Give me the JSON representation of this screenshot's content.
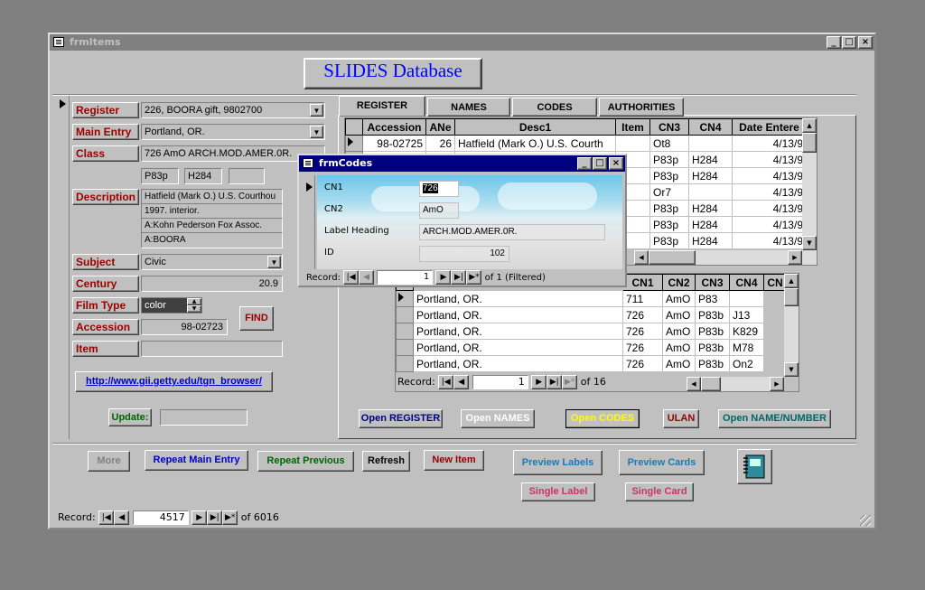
{
  "main_window": {
    "title": "frmItems"
  },
  "header": {
    "title": "SLIDES Database"
  },
  "fields": {
    "register": {
      "label": "Register",
      "value": "226, BOORA gift, 9802700"
    },
    "main_entry": {
      "label": "Main Entry",
      "value": "Portland, OR."
    },
    "class": {
      "label": "Class",
      "value": "726  AmO  ARCH.MOD.AMER.0R.",
      "sub1": "P83p",
      "sub2": "H284",
      "sub3": ""
    },
    "description": {
      "label": "Description",
      "lines": [
        "Hatfield (Mark O.) U.S. Courthou",
        "1997. interior.",
        "A:Kohn Pederson Fox Assoc.",
        "A:BOORA"
      ]
    },
    "subject": {
      "label": "Subject",
      "value": "Civic"
    },
    "century": {
      "label": "Century",
      "value": "20.9"
    },
    "film_type": {
      "label": "Film Type",
      "value": "color"
    },
    "accession": {
      "label": "Accession",
      "value": "98-02723"
    },
    "item": {
      "label": "Item",
      "value": ""
    }
  },
  "find_button": "FIND",
  "link": "http://www.gii.getty.edu/tgn_browser/",
  "update": {
    "label": "Update:",
    "value": ""
  },
  "tabs": [
    "REGISTER",
    "NAMES",
    "CODES",
    "AUTHORITIES"
  ],
  "grid1": {
    "headers": [
      "Accession",
      "ANe",
      "Desc1",
      "Item",
      "CN3",
      "CN4",
      "Date Entere"
    ],
    "rows": [
      [
        "98-02725",
        "26",
        "Hatfield (Mark O.) U.S. Courth",
        "",
        "Ot8",
        "",
        "4/13/9"
      ],
      [
        "",
        "",
        "",
        "",
        "P83p",
        "H284",
        "4/13/9"
      ],
      [
        "",
        "",
        "",
        "",
        "P83p",
        "H284",
        "4/13/9"
      ],
      [
        "",
        "",
        "",
        "",
        "Or7",
        "",
        "4/13/9"
      ],
      [
        "",
        "",
        "",
        "",
        "P83p",
        "H284",
        "4/13/9"
      ],
      [
        "",
        "",
        "",
        "",
        "P83p",
        "H284",
        "4/13/9"
      ],
      [
        "",
        "",
        "",
        "",
        "P83p",
        "H284",
        "4/13/9"
      ]
    ]
  },
  "grid2": {
    "headers": [
      "CN1",
      "CN2",
      "CN3",
      "CN4",
      "CN"
    ],
    "rows": [
      [
        "Portland, OR.",
        "711",
        "AmO",
        "P83",
        ""
      ],
      [
        "Portland, OR.",
        "726",
        "AmO",
        "P83b",
        "J13"
      ],
      [
        "Portland, OR.",
        "726",
        "AmO",
        "P83b",
        "K829"
      ],
      [
        "Portland, OR.",
        "726",
        "AmO",
        "P83b",
        "M78"
      ],
      [
        "Portland, OR.",
        "726",
        "AmO",
        "P83b",
        "On2"
      ]
    ],
    "nav": {
      "label": "Record:",
      "current": "1",
      "of_label": "of",
      "total": "16"
    }
  },
  "popup": {
    "title": "frmCodes",
    "cn1": {
      "label": "CN1",
      "value": "726"
    },
    "cn2": {
      "label": "CN2",
      "value": "AmO"
    },
    "label_heading": {
      "label": "Label Heading",
      "value": "ARCH.MOD.AMER.0R."
    },
    "id": {
      "label": "ID",
      "value": "102"
    },
    "nav": {
      "label": "Record:",
      "current": "1",
      "of_label": "of",
      "total": "1 (Filtered)"
    }
  },
  "open_buttons": [
    "Open REGISTER",
    "Open NAMES",
    "Open CODES",
    "ULAN",
    "Open NAME/NUMBER"
  ],
  "bottom_buttons": [
    "More",
    "Repeat Main Entry",
    "Repeat Previous",
    "Refresh",
    "New Item"
  ],
  "preview_buttons": [
    "Preview Labels",
    "Preview Cards",
    "Single Label",
    "Single Card"
  ],
  "main_nav": {
    "label": "Record:",
    "current": "4517",
    "of_label": "of",
    "total": "6016"
  },
  "colors": {
    "label_red": "#990000",
    "title_blue": "#0000ff",
    "link_blue": "#0000cc"
  }
}
